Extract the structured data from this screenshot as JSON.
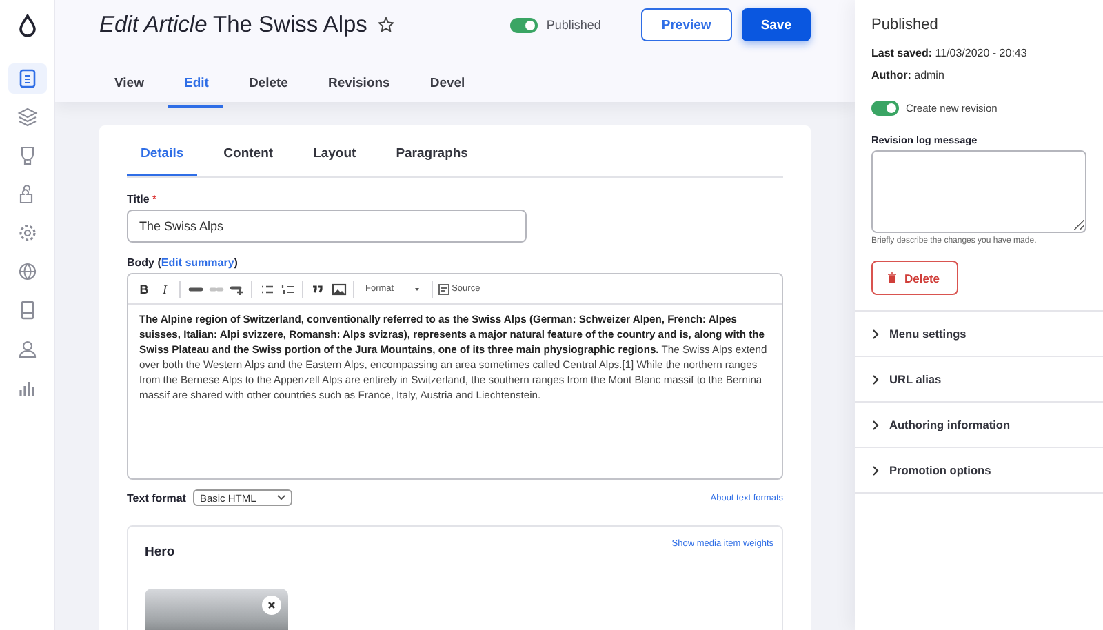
{
  "nav_items": [
    {
      "selected": true
    },
    {
      "selected": false
    },
    {
      "selected": false
    },
    {
      "selected": false
    },
    {
      "selected": false
    },
    {
      "selected": false
    },
    {
      "selected": false
    },
    {
      "selected": false
    },
    {
      "selected": false
    }
  ],
  "header": {
    "title_prefix": "Edit Article",
    "title": "The Swiss Alps",
    "favorite": false,
    "status_toggle": {
      "label": "Published",
      "on": true
    },
    "buttons": [
      {
        "label": "Preview",
        "kind": "secondary"
      },
      {
        "label": "Save",
        "kind": "primary"
      }
    ],
    "tabs": [
      {
        "label": "View",
        "selected": false
      },
      {
        "label": "Edit",
        "selected": true
      },
      {
        "label": "Delete",
        "selected": false
      },
      {
        "label": "Revisions",
        "selected": false
      },
      {
        "label": "Devel",
        "selected": false
      }
    ]
  },
  "form": {
    "tabs": [
      {
        "label": "Details",
        "selected": true
      },
      {
        "label": "Content",
        "selected": false
      },
      {
        "label": "Layout",
        "selected": false
      },
      {
        "label": "Paragraphs",
        "selected": false
      }
    ],
    "title_field": {
      "label": "Title",
      "required_mark": "*",
      "value": "The Swiss Alps"
    },
    "body": {
      "label": "Body (",
      "link": "Edit summary",
      "label_end": ")",
      "toolbar": [
        {
          "kind": "text",
          "label": "B"
        },
        {
          "kind": "text",
          "label": "I"
        },
        {
          "kind": "separator"
        },
        {
          "kind": "icon",
          "disabled": false
        },
        {
          "kind": "icon",
          "disabled": true
        },
        {
          "kind": "icon",
          "disabled": false
        },
        {
          "kind": "separator"
        },
        {
          "kind": "icon",
          "disabled": false
        },
        {
          "kind": "icon",
          "disabled": false
        },
        {
          "kind": "separator"
        },
        {
          "kind": "icon",
          "disabled": false
        },
        {
          "kind": "icon",
          "disabled": false
        },
        {
          "kind": "separator"
        },
        {
          "kind": "dropdown",
          "label": "Format"
        },
        {
          "kind": "separator"
        },
        {
          "kind": "source",
          "label": "Source"
        }
      ],
      "text": "**The Alpine region of Switzerland, conventionally referred to as the Swiss Alps (German: Schweizer Alpen, French: Alpes suisses, Italian: Alpi svizzere, Romansh: Alps svizras), represents a major natural feature of the country and is, along with the Swiss Plateau and the Swiss portion of the Jura Mountains, one of its three main physiographic regions.** The Swiss Alps extend over both the Western Alps and the Eastern Alps, encompassing an area sometimes called Central Alps.[1] While the northern ranges from the Bernese Alps to the Appenzell Alps are entirely in Switzerland, the southern ranges from the Mont Blanc massif to the Bernina massif are shared with other countries such as France, Italy, Austria and Liechtenstein."
    },
    "text_format": {
      "label": "Text format",
      "value": "Basic HTML",
      "link": "About text formats"
    },
    "hero": {
      "title": "Hero",
      "link": "Show media item weights"
    }
  },
  "sidebar": {
    "status": "Published",
    "meta": [
      {
        "label": "Last saved:",
        "value": "11/03/2020 - 20:43"
      },
      {
        "label": "Author:",
        "value": "admin"
      }
    ],
    "revision_toggle": {
      "label": "Create new revision",
      "on": true
    },
    "log": {
      "label": "Revision log message",
      "hint": "Briefly describe the changes you have made."
    },
    "delete_button": "Delete",
    "sections": [
      {
        "label": "Menu settings",
        "expanded": false
      },
      {
        "label": "URL alias",
        "expanded": false
      },
      {
        "label": "Authoring information",
        "expanded": false
      },
      {
        "label": "Promotion options",
        "expanded": false
      }
    ]
  }
}
